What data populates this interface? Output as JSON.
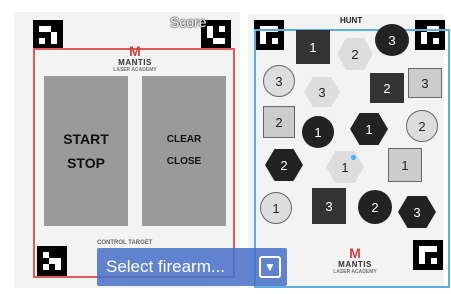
{
  "hud": {
    "score_label": "Score"
  },
  "control_sheet": {
    "logo": {
      "mark": "M",
      "name": "MANTIS",
      "sub": "LASER ACADEMY"
    },
    "start_stop": {
      "line1": "START",
      "line2": "STOP"
    },
    "clear_close": {
      "line1": "CLEAR",
      "line2": "CLOSE"
    },
    "label": "CONTROL TARGET"
  },
  "hunt_sheet": {
    "title": "HUNT",
    "logo": {
      "mark": "M",
      "name": "MANTIS",
      "sub": "LASER ACADEMY"
    },
    "targets": [
      {
        "shape": "sq-dark",
        "value": "1"
      },
      {
        "shape": "hx-light",
        "value": "2"
      },
      {
        "shape": "ci-dark",
        "value": "3"
      },
      {
        "shape": "ci-light",
        "value": "3"
      },
      {
        "shape": "hx-light",
        "value": "3"
      },
      {
        "shape": "sq-dark",
        "value": "2"
      },
      {
        "shape": "sq-light",
        "value": "3"
      },
      {
        "shape": "sq-light",
        "value": "2"
      },
      {
        "shape": "ci-dark",
        "value": "1"
      },
      {
        "shape": "hx-dark",
        "value": "1"
      },
      {
        "shape": "ci-light",
        "value": "2"
      },
      {
        "shape": "hx-dark",
        "value": "2"
      },
      {
        "shape": "hx-light",
        "value": "1"
      },
      {
        "shape": "sq-light",
        "value": "1"
      },
      {
        "shape": "ci-light",
        "value": "1"
      },
      {
        "shape": "sq-dark",
        "value": "3"
      },
      {
        "shape": "ci-dark",
        "value": "2"
      },
      {
        "shape": "hx-dark",
        "value": "3"
      }
    ]
  },
  "firearm_selector": {
    "label": "Select firearm...",
    "icon": "chevron-down-icon"
  },
  "colors": {
    "control_frame": "#e05a5a",
    "hunt_frame": "#5ab0e6",
    "selector_bg": "#466ec8"
  }
}
